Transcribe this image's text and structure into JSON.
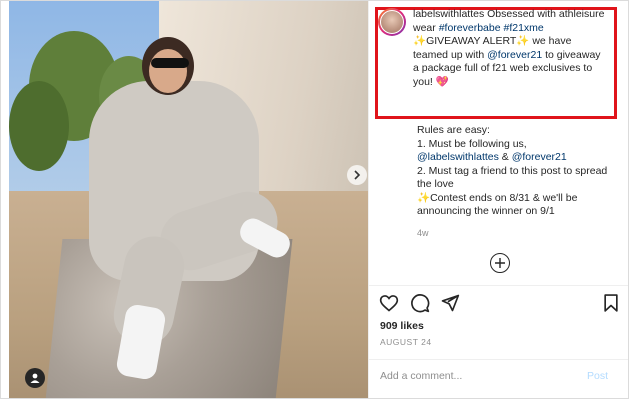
{
  "post": {
    "image_alt": "Woman in grey athleisure set sitting on a granite block",
    "next_icon": "chevron-right-icon",
    "user_tag_icon": "user-icon"
  },
  "caption": {
    "username": "labelswithlattes",
    "text_1": " Obsessed with athleisure wear ",
    "hashtag_1": "#foreverbabe",
    "hashtag_2": "#f21xme",
    "text_2": "✨GIVEAWAY ALERT✨ we have teamed up with ",
    "mention_1": "@forever21",
    "text_3": " to giveaway a package full of f21 web exclusives to you! 💖"
  },
  "rules": {
    "intro": "Rules are easy:",
    "line_1": "1. Must be following us,",
    "mention_a": "@labelswithlattes",
    "amp": " & ",
    "mention_b": "@forever21",
    "line_2": "2. Must tag a friend to this post to spread the love",
    "line_3": "✨Contest ends on 8/31 & we'll be announcing the winner on 9/1"
  },
  "meta": {
    "time_ago": "4w",
    "likes": "909 likes",
    "date": "AUGUST 24"
  },
  "comment": {
    "placeholder": "Add a comment...",
    "post_label": "Post"
  },
  "colors": {
    "highlight": "#e0141b",
    "link": "#00376b",
    "post_disabled": "#b3dbff"
  }
}
